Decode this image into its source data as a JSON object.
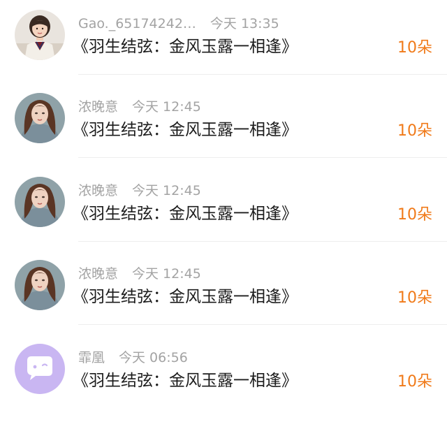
{
  "colors": {
    "accent": "#f07a19",
    "meta_text": "#a3a3a3",
    "gift_text": "#1c1c1c",
    "default_avatar_bg": "#c9b6f2"
  },
  "gifts": [
    {
      "avatar": "girl-photo-avatar",
      "name": "Gao._65174242…",
      "time": "今天 13:35",
      "gift": "《羽生结弦：金风玉露一相逢》",
      "count": "10朵"
    },
    {
      "avatar": "woman-photo-avatar",
      "name": "浓晚意",
      "time": "今天 12:45",
      "gift": "《羽生结弦：金风玉露一相逢》",
      "count": "10朵"
    },
    {
      "avatar": "woman-photo-avatar",
      "name": "浓晚意",
      "time": "今天 12:45",
      "gift": "《羽生结弦：金风玉露一相逢》",
      "count": "10朵"
    },
    {
      "avatar": "woman-photo-avatar",
      "name": "浓晚意",
      "time": "今天 12:45",
      "gift": "《羽生结弦：金风玉露一相逢》",
      "count": "10朵"
    },
    {
      "avatar": "default-chat-avatar",
      "name": "霏凰",
      "time": "今天 06:56",
      "gift": "《羽生结弦：金风玉露一相逢》",
      "count": "10朵"
    }
  ]
}
